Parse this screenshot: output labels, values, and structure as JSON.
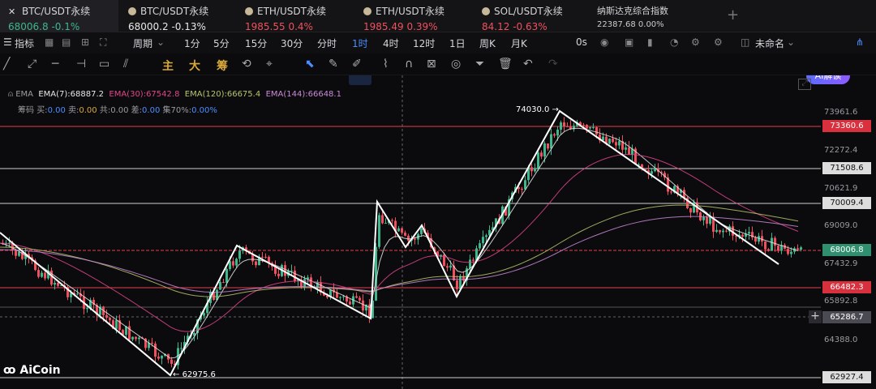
{
  "tabs": [
    {
      "name": "BTC/USDT永续",
      "price": "68006.8",
      "change": "-0.1%",
      "price_color": "up",
      "change_color": "up"
    },
    {
      "name": "BTC/USDT永续",
      "price": "68000.2",
      "change": "-0.13%",
      "price_color": "white",
      "change_color": "white"
    },
    {
      "name": "ETH/USDT永续",
      "price": "1985.55",
      "change": "0.4%",
      "price_color": "down",
      "change_color": "down"
    },
    {
      "name": "ETH/USDT永续",
      "price": "1985.49",
      "change": "0.39%",
      "price_color": "down",
      "change_color": "down"
    },
    {
      "name": "SOL/USDT永续",
      "price": "84.12",
      "change": "-0.63%",
      "price_color": "down",
      "change_color": "down"
    },
    {
      "name": "纳斯达克综合指数",
      "price": "22387.68",
      "change": "0.00%",
      "price_color": "white",
      "change_color": "white"
    }
  ],
  "toolbar": {
    "indicator": "指标",
    "period": "周期",
    "intervals": [
      "1分",
      "5分",
      "15分",
      "30分",
      "分时",
      "1时",
      "4时",
      "12时",
      "1日",
      "周K",
      "月K"
    ],
    "selected_interval": "1时",
    "zero_s": "0s",
    "unnamed": "未命名",
    "ai": "AI解读"
  },
  "drawing": {
    "zhu": "主",
    "da": "大",
    "chou": "筹"
  },
  "legend": {
    "ema_title": "EMA",
    "ema7": "EMA(7):68887.2",
    "ema30": "EMA(30):67542.8",
    "ema120": "EMA(120):66675.4",
    "ema144": "EMA(144):66648.1",
    "chip": "筹码",
    "buy": "买:",
    "buy_v": "0.00",
    "sell": "卖:",
    "sell_v": "0.00",
    "total": "共:0.00",
    "diff": "差:",
    "diff_v": "0.00",
    "conc": "集70%:",
    "conc_v": "0.00%"
  },
  "axis": [
    "73961.6",
    "72272.4",
    "70621.9",
    "69009.0",
    "67432.9",
    "65892.8",
    "64388.0"
  ],
  "levels": [
    {
      "label": "73360.6",
      "kind": "red"
    },
    {
      "label": "71508.6",
      "kind": "white"
    },
    {
      "label": "70009.4",
      "kind": "white"
    },
    {
      "label": "68006.8",
      "kind": "red"
    },
    {
      "label": "66482.3",
      "kind": "red"
    },
    {
      "label": "65286.7",
      "kind": "grey"
    },
    {
      "label": "62927.4",
      "kind": "white"
    }
  ],
  "annotations": {
    "high": "74030.0",
    "low": "62975.6"
  },
  "logo": "AiCoin",
  "colors": {
    "up": "#3fb68b",
    "down": "#f0505e",
    "accent": "#4c8dff",
    "ema7": "#e8e8e8",
    "ema30": "#e0458c",
    "ema120": "#b9c46e",
    "ema144": "#c98ad8"
  }
}
